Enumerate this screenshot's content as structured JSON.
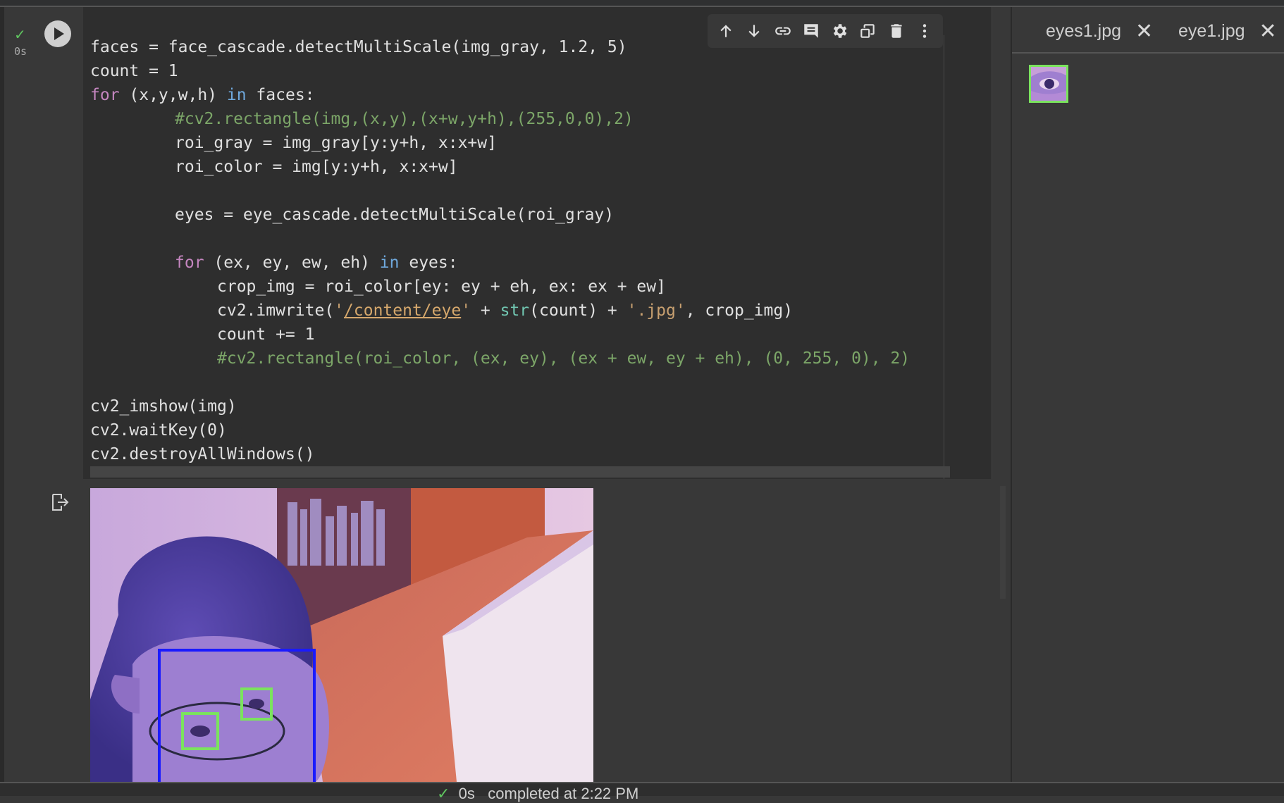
{
  "cell": {
    "status_check": "✓",
    "exec_time": "0s",
    "code_lines": [
      [
        {
          "t": "faces = face_cascade.detectMultiScale(img_gray, 1.2, 5)",
          "c": ""
        }
      ],
      [
        {
          "t": "count = 1",
          "c": ""
        }
      ],
      [
        {
          "t": "for",
          "c": "kw"
        },
        {
          "t": " (x,y,w,h) ",
          "c": ""
        },
        {
          "t": "in",
          "c": "op"
        },
        {
          "t": " faces:",
          "c": ""
        }
      ],
      [
        {
          "t": "#cv2.rectangle(img,(x,y),(x+w,y+h),(255,0,0),2)",
          "c": "cm",
          "i": 1
        }
      ],
      [
        {
          "t": "roi_gray = img_gray[y:y+h, x:x+w]",
          "c": "",
          "i": 1
        }
      ],
      [
        {
          "t": "roi_color = img[y:y+h, x:x+w]",
          "c": "",
          "i": 1
        }
      ],
      [],
      [
        {
          "t": "eyes = eye_cascade.detectMultiScale(roi_gray)",
          "c": "",
          "i": 1
        }
      ],
      [],
      [
        {
          "t": "for",
          "c": "kw",
          "i": 1
        },
        {
          "t": " (ex, ey, ew, eh) ",
          "c": ""
        },
        {
          "t": "in",
          "c": "op"
        },
        {
          "t": " eyes:",
          "c": ""
        }
      ],
      [
        {
          "t": "crop_img = roi_color[ey: ey + eh, ex: ex + ew]",
          "c": "",
          "i": 2
        }
      ],
      [
        {
          "t": "cv2.imwrite(",
          "c": "",
          "i": 2
        },
        {
          "t": "'",
          "c": "st"
        },
        {
          "t": "/content/eye",
          "c": "url"
        },
        {
          "t": "'",
          "c": "st"
        },
        {
          "t": " + ",
          "c": ""
        },
        {
          "t": "str",
          "c": "fn"
        },
        {
          "t": "(count) + ",
          "c": ""
        },
        {
          "t": "'.jpg'",
          "c": "st"
        },
        {
          "t": ", crop_img)",
          "c": ""
        }
      ],
      [
        {
          "t": "count += 1",
          "c": "",
          "i": 2
        }
      ],
      [
        {
          "t": "#cv2.rectangle(roi_color, (ex, ey), (ex + ew, ey + eh), (0, 255, 0), 2)",
          "c": "cm",
          "i": 2
        }
      ],
      [],
      [
        {
          "t": "cv2_imshow(img)",
          "c": ""
        }
      ],
      [
        {
          "t": "cv2.waitKey(0)",
          "c": ""
        }
      ],
      [
        {
          "t": "cv2.destroyAllWindows()",
          "c": ""
        }
      ]
    ]
  },
  "toolbar": {
    "icons": [
      "arrow-up-icon",
      "arrow-down-icon",
      "link-icon",
      "comment-icon",
      "gear-icon",
      "mirror-cell-icon",
      "trash-icon",
      "more-vert-icon"
    ]
  },
  "right_panel": {
    "tabs": [
      {
        "label": "eyes1.jpg",
        "close": "✕"
      },
      {
        "label": "eye1.jpg",
        "close": "✕"
      }
    ]
  },
  "status_bar": {
    "check": "✓",
    "time": "0s",
    "text": "completed at 2:22 PM"
  },
  "colors": {
    "face_box": "#1a1aff",
    "eye_box": "#7be35e"
  }
}
